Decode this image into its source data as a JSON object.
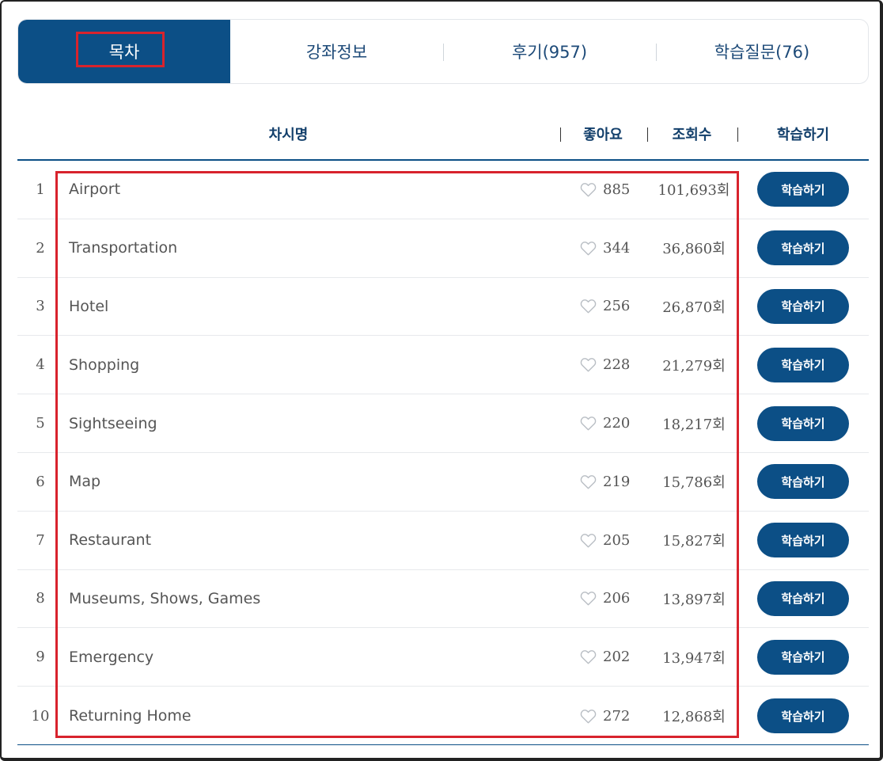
{
  "tabs": [
    {
      "label": "목차",
      "active": true
    },
    {
      "label": "강좌정보",
      "active": false
    },
    {
      "label": "후기(957)",
      "active": false
    },
    {
      "label": "학습질문(76)",
      "active": false
    }
  ],
  "table": {
    "headers": {
      "name": "차시명",
      "likes": "좋아요",
      "views": "조회수",
      "learn": "학습하기"
    },
    "rows": [
      {
        "num": "1",
        "title": "Airport",
        "likes": "885",
        "views": "101,693회",
        "button": "학습하기"
      },
      {
        "num": "2",
        "title": "Transportation",
        "likes": "344",
        "views": "36,860회",
        "button": "학습하기"
      },
      {
        "num": "3",
        "title": "Hotel",
        "likes": "256",
        "views": "26,870회",
        "button": "학습하기"
      },
      {
        "num": "4",
        "title": "Shopping",
        "likes": "228",
        "views": "21,279회",
        "button": "학습하기"
      },
      {
        "num": "5",
        "title": "Sightseeing",
        "likes": "220",
        "views": "18,217회",
        "button": "학습하기"
      },
      {
        "num": "6",
        "title": "Map",
        "likes": "219",
        "views": "15,786회",
        "button": "학습하기"
      },
      {
        "num": "7",
        "title": "Restaurant",
        "likes": "205",
        "views": "15,827회",
        "button": "학습하기"
      },
      {
        "num": "8",
        "title": "Museums, Shows, Games",
        "likes": "206",
        "views": "13,897회",
        "button": "학습하기"
      },
      {
        "num": "9",
        "title": "Emergency",
        "likes": "202",
        "views": "13,947회",
        "button": "학습하기"
      },
      {
        "num": "10",
        "title": "Returning Home",
        "likes": "272",
        "views": "12,868회",
        "button": "학습하기"
      }
    ]
  },
  "icons": {
    "like": "heart-outline-icon"
  },
  "colors": {
    "primary": "#0c4f86",
    "highlight": "#d8232d",
    "text": "#555555"
  }
}
